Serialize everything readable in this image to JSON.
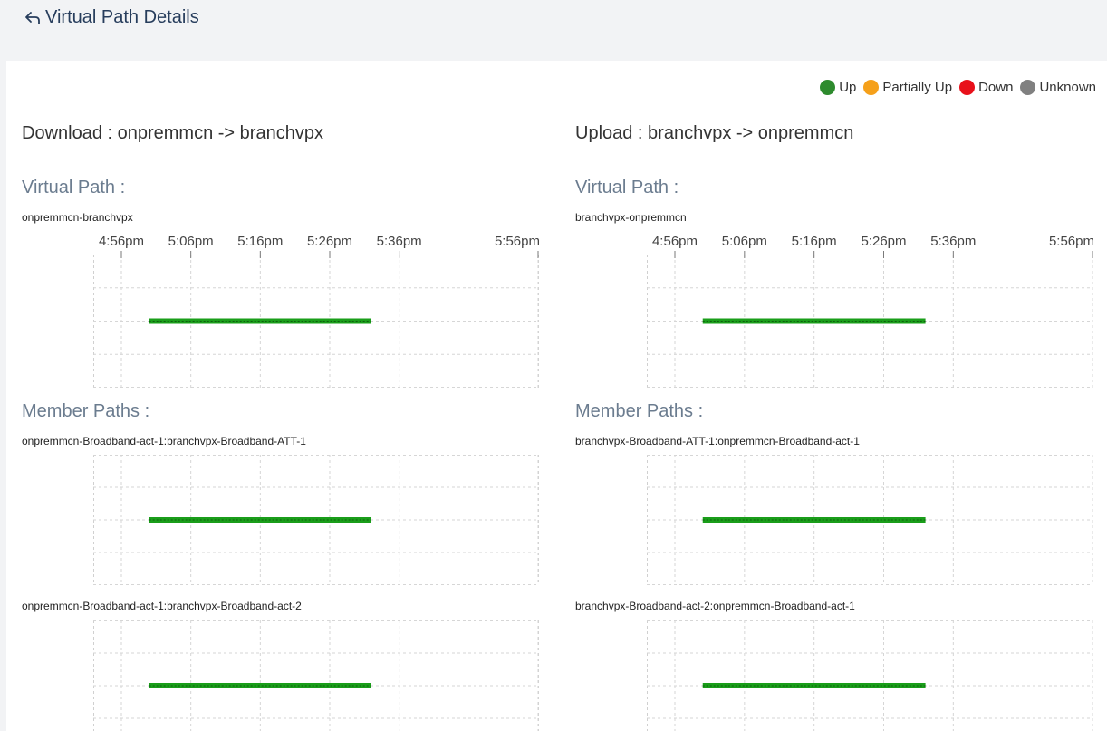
{
  "header": {
    "title": "Virtual Path Details",
    "back_icon": "back-arrow-icon"
  },
  "legend": [
    {
      "label": "Up",
      "color": "#2e8b2e"
    },
    {
      "label": "Partially Up",
      "color": "#f5a01a"
    },
    {
      "label": "Down",
      "color": "#e8101a"
    },
    {
      "label": "Unknown",
      "color": "#808080"
    }
  ],
  "time_ticks": [
    "4:56pm",
    "5:06pm",
    "5:16pm",
    "5:26pm",
    "5:36pm",
    "5:56pm"
  ],
  "download": {
    "title": "Download : onpremmcn -> branchvpx",
    "virtual_path_heading": "Virtual Path :",
    "virtual_path_name": "onpremmcn-branchvpx",
    "member_paths_heading": "Member Paths :",
    "member_paths": [
      "onpremmcn-Broadband-act-1:branchvpx-Broadband-ATT-1",
      "onpremmcn-Broadband-act-1:branchvpx-Broadband-act-2"
    ]
  },
  "upload": {
    "title": "Upload : branchvpx -> onpremmcn",
    "virtual_path_heading": "Virtual Path :",
    "virtual_path_name": "branchvpx-onpremmcn",
    "member_paths_heading": "Member Paths :",
    "member_paths": [
      "branchvpx-Broadband-ATT-1:onpremmcn-Broadband-act-1",
      "branchvpx-Broadband-act-2:onpremmcn-Broadband-act-1"
    ]
  },
  "chart_data": [
    {
      "type": "timeline",
      "name": "onpremmcn-branchvpx",
      "status": "Up",
      "color": "#1a9e1a",
      "start": "5:00pm",
      "end": "5:32pm"
    },
    {
      "type": "timeline",
      "name": "onpremmcn-Broadband-act-1:branchvpx-Broadband-ATT-1",
      "status": "Up",
      "color": "#1a9e1a",
      "start": "5:00pm",
      "end": "5:32pm"
    },
    {
      "type": "timeline",
      "name": "onpremmcn-Broadband-act-1:branchvpx-Broadband-act-2",
      "status": "Up",
      "color": "#1a9e1a",
      "start": "5:00pm",
      "end": "5:32pm"
    },
    {
      "type": "timeline",
      "name": "branchvpx-onpremmcn",
      "status": "Up",
      "color": "#1a9e1a",
      "start": "5:00pm",
      "end": "5:32pm"
    },
    {
      "type": "timeline",
      "name": "branchvpx-Broadband-ATT-1:onpremmcn-Broadband-act-1",
      "status": "Up",
      "color": "#1a9e1a",
      "start": "5:00pm",
      "end": "5:32pm"
    },
    {
      "type": "timeline",
      "name": "branchvpx-Broadband-act-2:onpremmcn-Broadband-act-1",
      "status": "Up",
      "color": "#1a9e1a",
      "start": "5:00pm",
      "end": "5:32pm"
    }
  ]
}
